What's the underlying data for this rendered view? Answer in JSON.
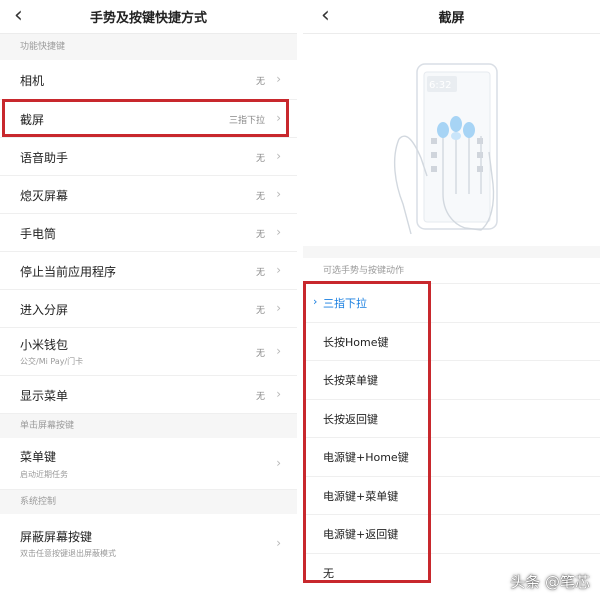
{
  "left": {
    "title": "手势及按键快捷方式",
    "back_icon": "chevron-left-icon",
    "sections": [
      {
        "header": "功能快捷键",
        "rows": [
          {
            "label": "相机",
            "value": "无"
          },
          {
            "label": "截屏",
            "value": "三指下拉"
          },
          {
            "label": "语音助手",
            "value": "无"
          },
          {
            "label": "熄灭屏幕",
            "value": "无"
          },
          {
            "label": "手电筒",
            "value": "无"
          },
          {
            "label": "停止当前应用程序",
            "value": "无"
          },
          {
            "label": "进入分屏",
            "value": "无"
          },
          {
            "label": "小米钱包",
            "sub": "公交/Mi Pay/门卡",
            "value": "无"
          },
          {
            "label": "显示菜单",
            "value": "无"
          }
        ]
      },
      {
        "header": "单击屏幕按键",
        "rows": [
          {
            "label": "菜单键",
            "sub": "启动近期任务"
          }
        ]
      },
      {
        "header": "系统控制",
        "rows": [
          {
            "label": "屏蔽屏幕按键",
            "sub": "双击任意按键退出屏蔽模式"
          }
        ]
      }
    ]
  },
  "right": {
    "title": "截屏",
    "back_icon": "chevron-left-icon",
    "illustration": {
      "time": "6:32"
    },
    "options_header": "可选手势与按键动作",
    "options": [
      {
        "label": "三指下拉",
        "selected": true
      },
      {
        "label": "长按Home键",
        "selected": false
      },
      {
        "label": "长按菜单键",
        "selected": false
      },
      {
        "label": "长按返回键",
        "selected": false
      },
      {
        "label": "电源键+Home键",
        "selected": false
      },
      {
        "label": "电源键+菜单键",
        "selected": false
      },
      {
        "label": "电源键+返回键",
        "selected": false
      },
      {
        "label": "无",
        "selected": false
      }
    ]
  },
  "watermark": "头条 @笔芯",
  "colors": {
    "accent": "#1a7fe0",
    "highlight": "#c8282d",
    "section_bg": "#f6f6f6"
  }
}
